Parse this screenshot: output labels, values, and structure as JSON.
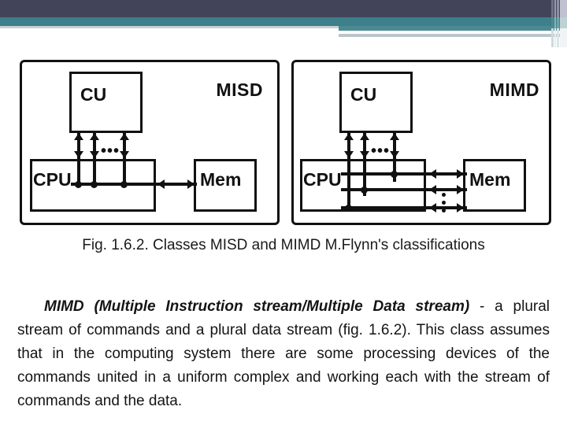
{
  "banner": {
    "colors": {
      "dark_slate": "#424559",
      "teal": "#3d7f8a",
      "teal_light": "#4c8a93",
      "gray_blue": "#c6cfd4"
    }
  },
  "figure": {
    "panels": [
      {
        "id": "misd",
        "title": "MISD",
        "nodes": {
          "cu": "CU",
          "cpu": "CPU",
          "mem": "Mem"
        },
        "ellipsis": "•••"
      },
      {
        "id": "mimd",
        "title": "MIMD",
        "nodes": {
          "cu": "CU",
          "cpu": "CPU",
          "mem": "Mem"
        },
        "ellipsis": "•••"
      }
    ]
  },
  "caption": "Fig. 1.6.2. Classes MISD and MIMD M.Flynn's classifications",
  "paragraph": {
    "bold_lead": "MIMD (Multiple Instruction stream/Multiple Data stream)",
    "rest": " - a plural stream of commands and a plural data stream (fig. 1.6.2). This class assumes that in the computing system there are some processing devices of the commands united in a uniform complex and working each with the stream of commands and the data."
  }
}
